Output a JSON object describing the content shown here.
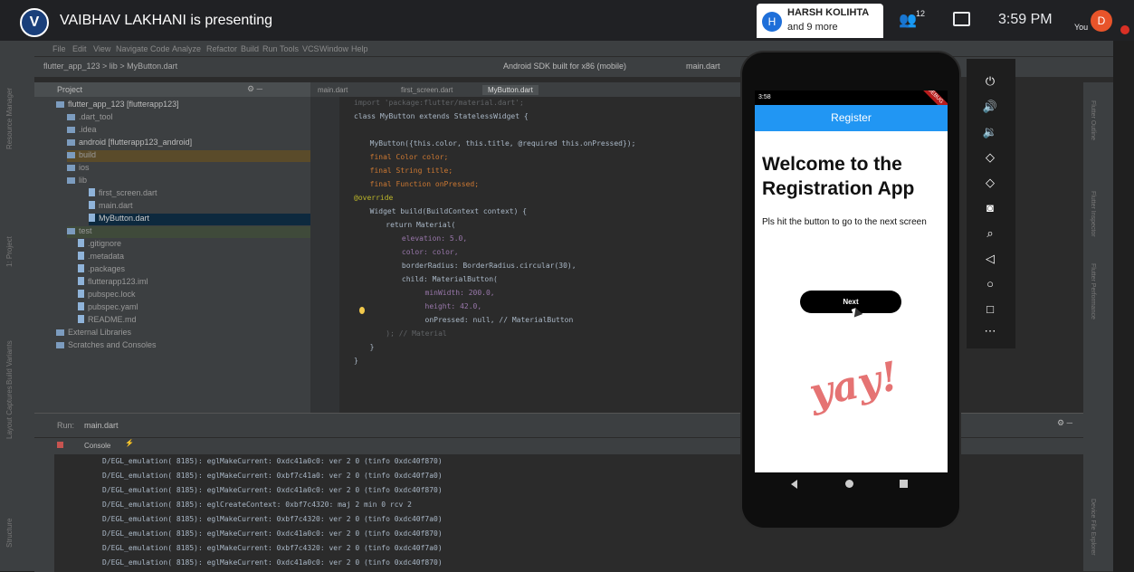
{
  "meeting": {
    "presenter_initial": "V",
    "presenter_title": "VAIBHAV LAKHANI is presenting",
    "chip_initial": "H",
    "chip_name": "HARSH KOLIHTA",
    "chip_sub": "and 9 more",
    "people_count": "12",
    "time": "3:59 PM",
    "you_label": "You",
    "you_initial": "D"
  },
  "ide": {
    "menu": [
      "File",
      "Edit",
      "View",
      "Navigate",
      "Code",
      "Analyze",
      "Refactor",
      "Build",
      "Run",
      "Tools",
      "VCS",
      "Window",
      "Help"
    ],
    "breadcrumb": "flutter_app_123 > lib > MyButton.dart",
    "device": "Android SDK built for x86 (mobile)",
    "run_config": "main.dart",
    "project_label": "Project",
    "tabs": [
      "main.dart",
      "first_screen.dart",
      "MyButton.dart"
    ],
    "tree": [
      {
        "label": "flutter_app_123 [flutterapp123]",
        "type": "folder"
      },
      {
        "label": ".dart_tool",
        "type": "folder"
      },
      {
        "label": ".idea",
        "type": "folder"
      },
      {
        "label": "android [flutterapp123_android]",
        "type": "folder"
      },
      {
        "label": "build",
        "type": "folder"
      },
      {
        "label": "ios",
        "type": "folder"
      },
      {
        "label": "lib",
        "type": "folder"
      },
      {
        "label": "first_screen.dart",
        "type": "file"
      },
      {
        "label": "main.dart",
        "type": "file"
      },
      {
        "label": "MyButton.dart",
        "type": "file"
      },
      {
        "label": "test",
        "type": "folder"
      },
      {
        "label": ".gitignore",
        "type": "file"
      },
      {
        "label": ".metadata",
        "type": "file"
      },
      {
        "label": ".packages",
        "type": "file"
      },
      {
        "label": "flutterapp123.iml",
        "type": "file"
      },
      {
        "label": "pubspec.lock",
        "type": "file"
      },
      {
        "label": "pubspec.yaml",
        "type": "file"
      },
      {
        "label": "README.md",
        "type": "file"
      },
      {
        "label": "External Libraries",
        "type": "folder"
      },
      {
        "label": "Scratches and Consoles",
        "type": "folder"
      }
    ],
    "code": [
      "import 'package:flutter/material.dart';",
      "class MyButton extends StatelessWidget {",
      "",
      "  MyButton({this.color, this.title, @required this.onPressed});",
      "  final Color color;",
      "  final String title;",
      "  final Function onPressed;",
      "@override",
      "  Widget build(BuildContext context) {",
      "    return Material(",
      "      elevation: 5.0,",
      "      color: color,",
      "      borderRadius: BorderRadius.circular(30),",
      "      child: MaterialButton(",
      "        minWidth: 200.0,",
      "        height: 42.0,",
      "        onPressed: null, // MaterialButton",
      "    ); // Material",
      "  }",
      "}"
    ],
    "run_tab": "Run:",
    "run_config_tab": "main.dart",
    "console_label": "Console",
    "log": [
      "D/EGL_emulation( 8185): eglMakeCurrent: 0xdc41a0c0: ver 2 0 (tinfo 0xdc40f870)",
      "D/EGL_emulation( 8185): eglMakeCurrent: 0xbf7c41a0: ver 2 0 (tinfo 0xdc40f7a0)",
      "D/EGL_emulation( 8185): eglMakeCurrent: 0xdc41a0c0: ver 2 0 (tinfo 0xdc40f870)",
      "D/EGL_emulation( 8185): eglCreateContext: 0xbf7c4320: maj 2 min 0 rcv 2",
      "D/EGL_emulation( 8185): eglMakeCurrent: 0xbf7c4320: ver 2 0 (tinfo 0xdc40f7a0)",
      "D/EGL_emulation( 8185): eglMakeCurrent: 0xdc41a0c0: ver 2 0 (tinfo 0xdc40f870)",
      "D/EGL_emulation( 8185): eglMakeCurrent: 0xbf7c4320: ver 2 0 (tinfo 0xdc40f7a0)",
      "D/EGL_emulation( 8185): eglMakeCurrent: 0xdc41a0c0: ver 2 0 (tinfo 0xdc40f870)"
    ]
  },
  "phone": {
    "time": "3:58",
    "debug": "DEBUG",
    "appbar_title": "Register",
    "welcome": "Welcome to the Registration App",
    "subtitle": "Pls hit the button to go to the next screen",
    "button_label": "Next",
    "yay": "yay!"
  }
}
